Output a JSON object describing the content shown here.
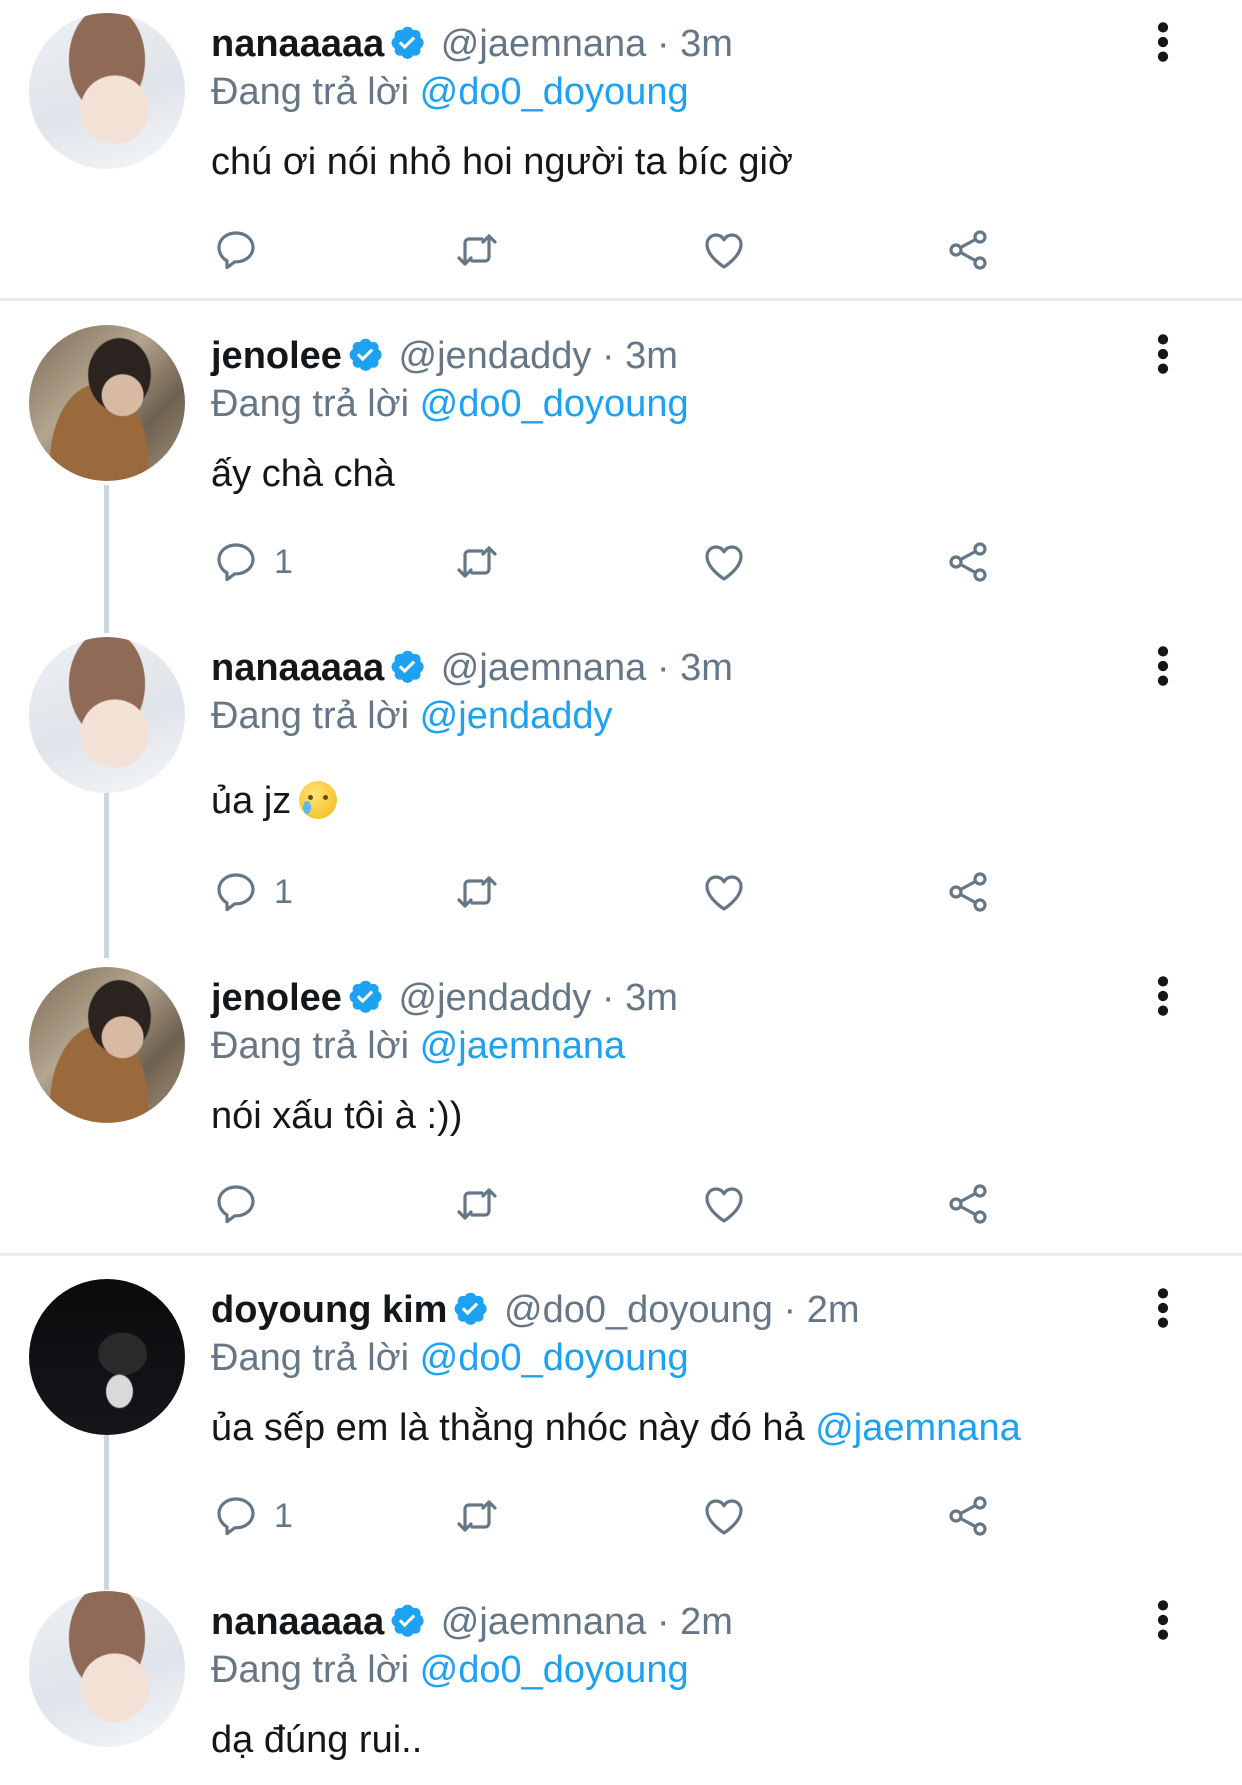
{
  "colors": {
    "accent": "#1da1f2",
    "secondary": "#657786",
    "text": "#14171a",
    "divider": "#e6ecf0"
  },
  "replying_label": "Đang trả lời",
  "tweets": [
    {
      "name": "nanaaaaa",
      "handle": "@jaemnana",
      "sep": "·",
      "time": "3m",
      "reply_to": "@do0_doyoung",
      "text": "chú ơi nói nhỏ hoi người ta bíc giờ",
      "reply_count": "",
      "avatar": "nana-avatar",
      "verified_icon": "verified-badge-icon"
    },
    {
      "name": "jenolee",
      "handle": "@jendaddy",
      "sep": "·",
      "time": "3m",
      "reply_to": "@do0_doyoung",
      "text": "ấy chà chà",
      "reply_count": "1",
      "avatar": "jeno-avatar",
      "verified_icon": "verified-badge-icon"
    },
    {
      "name": "nanaaaaa",
      "handle": "@jaemnana",
      "sep": "·",
      "time": "3m",
      "reply_to": "@jendaddy",
      "text": "ủa jz",
      "reply_count": "1",
      "avatar": "nana-avatar",
      "emoji": "crying-face-emoji"
    },
    {
      "name": "jenolee",
      "handle": "@jendaddy",
      "sep": "·",
      "time": "3m",
      "reply_to": "@jaemnana",
      "text": "nói xấu tôi à :))",
      "reply_count": "",
      "avatar": "jeno-avatar"
    },
    {
      "name": "doyoung kim",
      "handle": "@do0_doyoung",
      "sep": "·",
      "time": "2m",
      "reply_to": "@do0_doyoung",
      "text": "ủa sếp em là thằng nhóc này đó hả",
      "text_mention": "@jaemnana",
      "reply_count": "1",
      "avatar": "doyoung-avatar"
    },
    {
      "name": "nanaaaaa",
      "handle": "@jaemnana",
      "sep": "·",
      "time": "2m",
      "reply_to": "@do0_doyoung",
      "text": "dạ đúng rui..",
      "reply_count": "",
      "avatar": "nana-avatar"
    }
  ]
}
